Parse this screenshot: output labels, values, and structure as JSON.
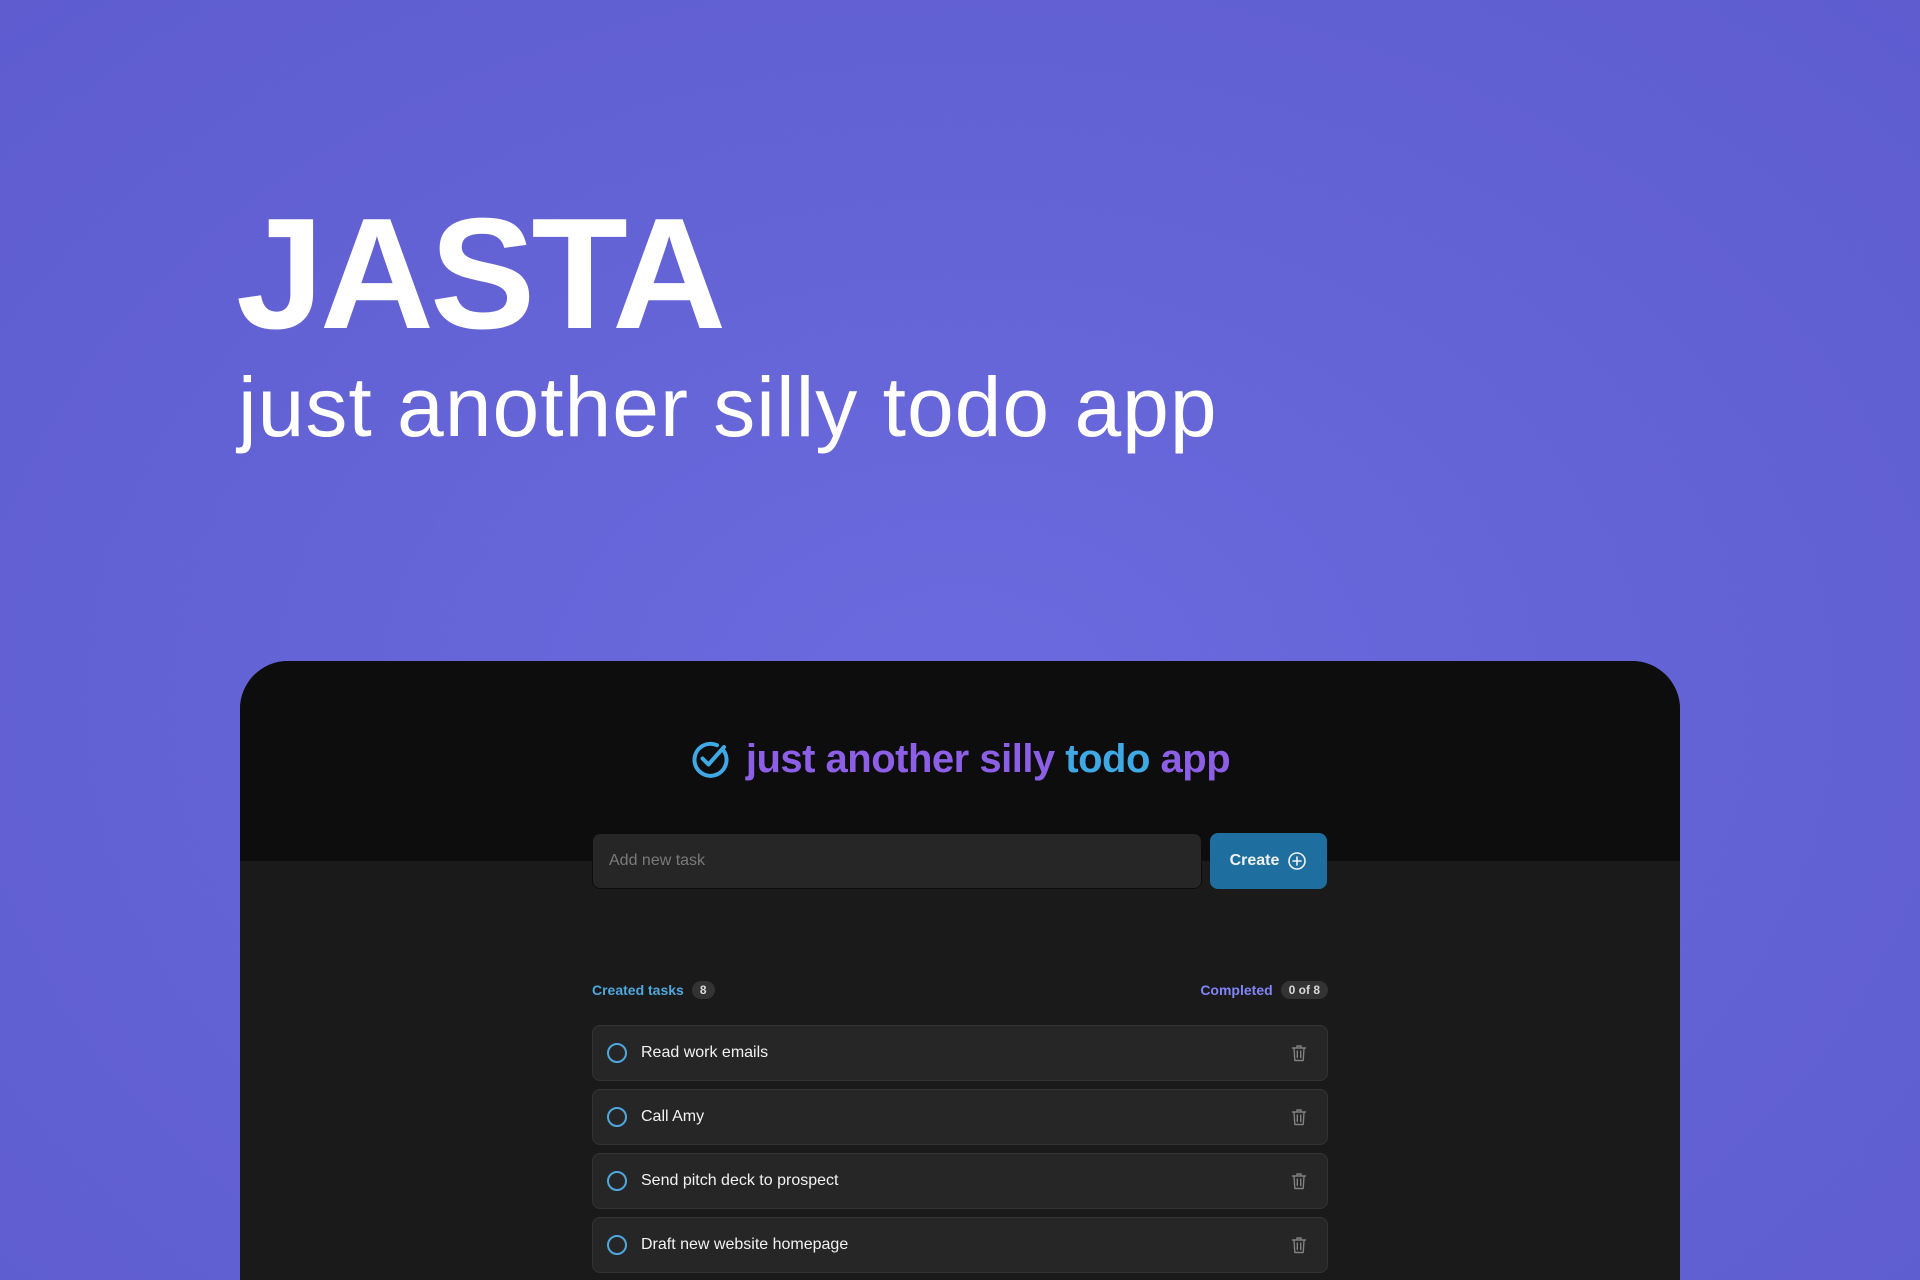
{
  "hero": {
    "title": "JASTA",
    "subtitle": "just another silly todo app"
  },
  "app": {
    "logo": {
      "icon": "check-circle-icon",
      "text_part1": "just another silly ",
      "text_accent": "todo",
      "text_part2": " app"
    },
    "new_task": {
      "placeholder": "Add new task",
      "value": "",
      "create_label": "Create",
      "create_icon": "plus-circle-icon"
    },
    "counters": {
      "created_label": "Created tasks",
      "created_count": "8",
      "completed_label": "Completed",
      "completed_count": "0 of 8"
    },
    "tasks": [
      {
        "text": "Read work emails",
        "completed": false
      },
      {
        "text": "Call Amy",
        "completed": false
      },
      {
        "text": "Send pitch deck to prospect",
        "completed": false
      },
      {
        "text": "Draft new website homepage",
        "completed": false
      }
    ]
  },
  "colors": {
    "background": "#6362d4",
    "app_header": "#0d0d0d",
    "app_body": "#1a1a1a",
    "purple": "#8d5fe6",
    "blue": "#3fa9e6",
    "created_blue": "#4ea8de",
    "completed_purple": "#8284fa",
    "button": "#1e6f9f"
  }
}
